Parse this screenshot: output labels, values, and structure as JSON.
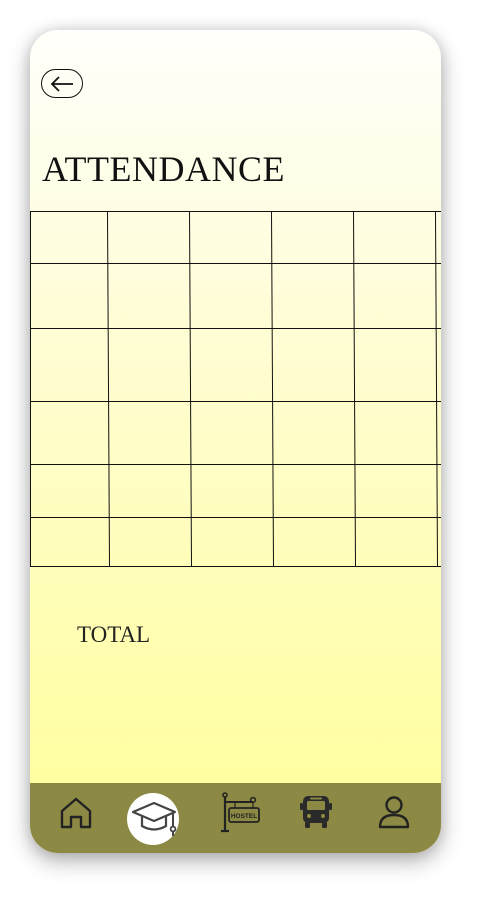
{
  "header": {
    "back_icon": "arrow-left-icon",
    "title": "ATTENDANCE"
  },
  "attendance_table": {
    "rows": 6,
    "columns": 6,
    "cells": [
      [
        "",
        "",
        "",
        "",
        "",
        ""
      ],
      [
        "",
        "",
        "",
        "",
        "",
        ""
      ],
      [
        "",
        "",
        "",
        "",
        "",
        ""
      ],
      [
        "",
        "",
        "",
        "",
        "",
        ""
      ],
      [
        "",
        "",
        "",
        "",
        "",
        ""
      ],
      [
        "",
        "",
        "",
        "",
        "",
        ""
      ]
    ]
  },
  "summary": {
    "total_label": "TOTAL"
  },
  "bottom_nav": {
    "items": [
      {
        "icon": "home-icon",
        "active": false
      },
      {
        "icon": "graduation-cap-icon",
        "active": true
      },
      {
        "icon": "hostel-sign-icon",
        "label": "HOSTEL",
        "active": false
      },
      {
        "icon": "bus-icon",
        "active": false
      },
      {
        "icon": "user-icon",
        "active": false
      }
    ]
  },
  "colors": {
    "background_top": "#fffffb",
    "background_bottom": "#ffff99",
    "nav_background": "#8b8943",
    "grid_line": "#111111"
  }
}
